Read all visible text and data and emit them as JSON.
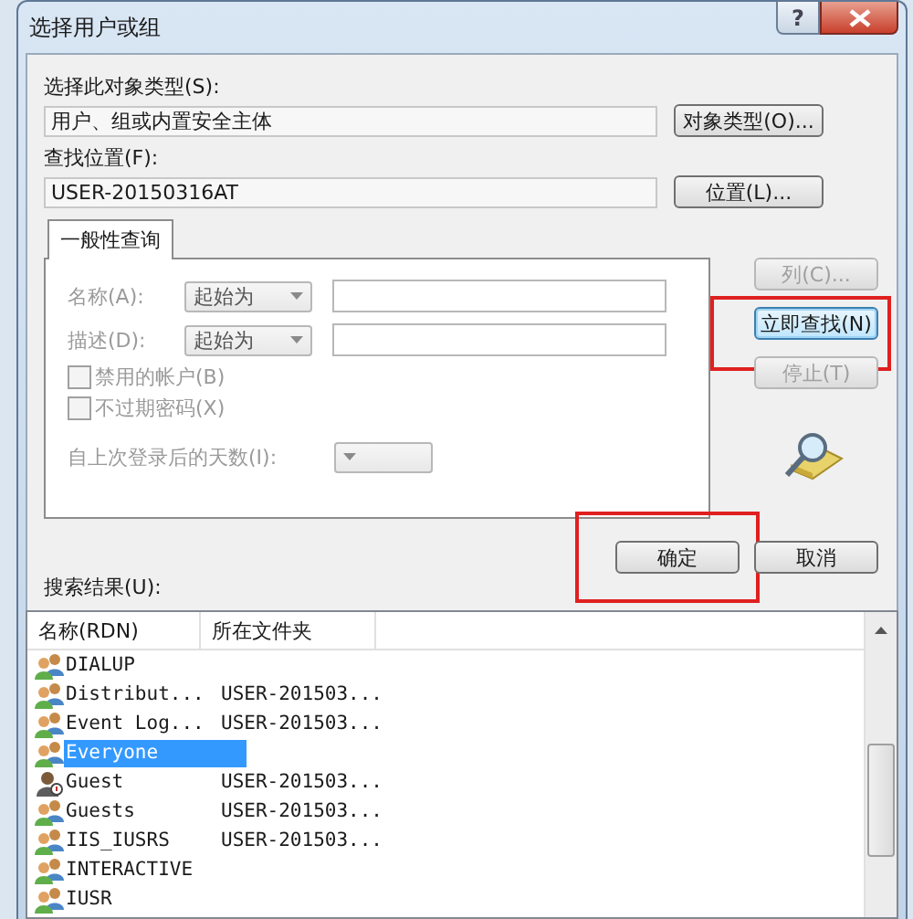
{
  "window": {
    "title": "选择用户或组",
    "help": "?"
  },
  "object_type": {
    "label": "选择此对象类型(S):",
    "value": "用户、组或内置安全主体",
    "button": "对象类型(O)..."
  },
  "location": {
    "label": "查找位置(F):",
    "value": "USER-20150316AT",
    "button": "位置(L)..."
  },
  "tabs": [
    {
      "label": "一般性查询",
      "selected": true
    }
  ],
  "query": {
    "disabled": true,
    "fields": [
      {
        "kind": "text",
        "label": "名称(A):",
        "mode": "起始为"
      },
      {
        "kind": "text",
        "label": "描述(D):",
        "mode": "起始为"
      },
      {
        "kind": "checkbox",
        "label": "禁用的帐户(B)",
        "checked": false
      },
      {
        "kind": "checkbox",
        "label": "不过期密码(X)",
        "checked": false
      },
      {
        "kind": "days",
        "label": "自上次登录后的天数(I):"
      }
    ]
  },
  "side_buttons": [
    {
      "label": "列(C)...",
      "disabled": true,
      "highlighted": false
    },
    {
      "label": "立即查找(N)",
      "disabled": false,
      "highlighted": true
    },
    {
      "label": "停止(T)",
      "disabled": true,
      "highlighted": false
    }
  ],
  "dialog_buttons": [
    {
      "label": "确定",
      "highlighted": true
    },
    {
      "label": "取消",
      "highlighted": false
    }
  ],
  "results": {
    "label": "搜索结果(U):",
    "columns": [
      "名称(RDN)",
      "所在文件夹"
    ],
    "rows": [
      {
        "kind": "group",
        "name": "DIALUP",
        "selected": false
      },
      {
        "kind": "group",
        "name": "Distribut...",
        "folder": "USER-201503...",
        "selected": false
      },
      {
        "kind": "group",
        "name": "Event Log...",
        "folder": "USER-201503...",
        "selected": false
      },
      {
        "kind": "group",
        "name": "Everyone",
        "selected": true
      },
      {
        "kind": "user",
        "name": "Guest",
        "folder": "USER-201503...",
        "selected": false
      },
      {
        "kind": "group",
        "name": "Guests",
        "folder": "USER-201503...",
        "selected": false
      },
      {
        "kind": "group",
        "name": "IIS_IUSRS",
        "folder": "USER-201503...",
        "selected": false
      },
      {
        "kind": "group",
        "name": "INTERACTIVE",
        "selected": false
      },
      {
        "kind": "group",
        "name": "IUSR",
        "selected": false
      }
    ]
  }
}
